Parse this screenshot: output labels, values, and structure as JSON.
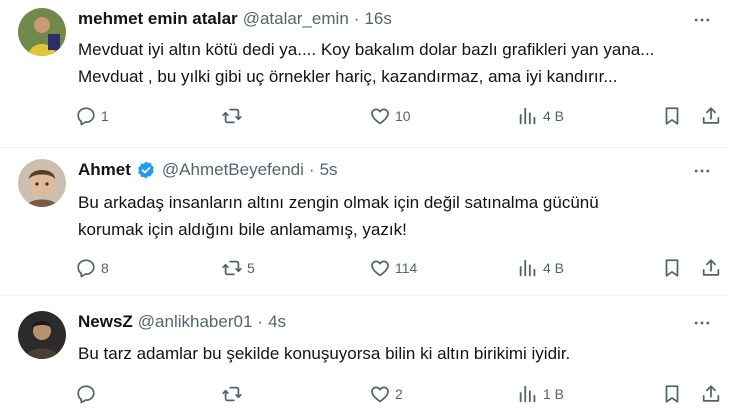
{
  "tweets": [
    {
      "name": "mehmet emin atalar",
      "verified": false,
      "handle": "@atalar_emin",
      "dot": "·",
      "time": "16s",
      "lines": [
        "Mevduat iyi altın kötü dedi ya.... Koy bakalım dolar bazlı grafikleri yan yana...",
        "Mevduat , bu yılki gibi uç örnekler hariç, kazandırmaz, ama iyi kandırır..."
      ],
      "replies": "1",
      "retweets": "",
      "likes": "10",
      "views": "4 B"
    },
    {
      "name": "Ahmet",
      "verified": true,
      "handle": "@AhmetBeyefendi",
      "dot": "·",
      "time": "5s",
      "lines": [
        "Bu arkadaş insanların altını zengin olmak için değil satınalma gücünü",
        "korumak için aldığını bile anlamamış, yazık!"
      ],
      "replies": "8",
      "retweets": "5",
      "likes": "114",
      "views": "4 B"
    },
    {
      "name": "NewsZ",
      "verified": false,
      "handle": "@anlikhaber01",
      "dot": "·",
      "time": "4s",
      "lines": [
        "Bu tarz adamlar bu şekilde konuşuyorsa bilin ki altın birikimi iyidir."
      ],
      "replies": "",
      "retweets": "",
      "likes": "2",
      "views": "1 B"
    }
  ],
  "icons": {
    "more": "more-horizontal-icon",
    "reply": "reply-icon",
    "retweet": "retweet-icon",
    "like": "heart-icon",
    "views": "views-chart-icon",
    "bookmark": "bookmark-icon",
    "share": "share-icon",
    "verified": "verified-badge-icon"
  },
  "colors": {
    "text": "#0f1419",
    "secondary": "#536471",
    "verified": "#1d9bf0",
    "divider": "#eff3f4"
  }
}
